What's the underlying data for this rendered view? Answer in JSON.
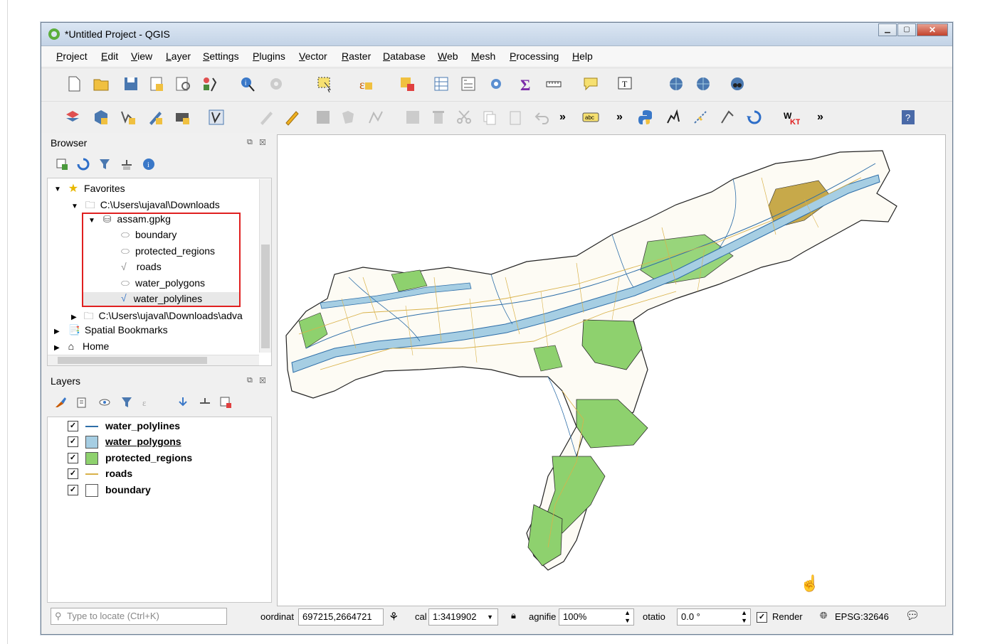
{
  "window": {
    "title": "*Untitled Project - QGIS"
  },
  "menu": [
    "Project",
    "Edit",
    "View",
    "Layer",
    "Settings",
    "Plugins",
    "Vector",
    "Raster",
    "Database",
    "Web",
    "Mesh",
    "Processing",
    "Help"
  ],
  "toolbar_overflow": "»",
  "browser": {
    "title": "Browser",
    "favorites": "Favorites",
    "downloads": "C:\\Users\\ujaval\\Downloads",
    "gpkg": "assam.gpkg",
    "layers": [
      "boundary",
      "protected_regions",
      "roads",
      "water_polygons",
      "water_polylines"
    ],
    "downloads_adv": "C:\\Users\\ujaval\\Downloads\\adva",
    "bookmarks": "Spatial Bookmarks",
    "home": "Home"
  },
  "layers_panel": {
    "title": "Layers",
    "items": [
      {
        "name": "water_polylines",
        "swatch": "line",
        "color": "#2e6ea8"
      },
      {
        "name": "water_polygons",
        "swatch": "fill",
        "color": "#a6cee3"
      },
      {
        "name": "protected_regions",
        "swatch": "fill",
        "color": "#8ed16e"
      },
      {
        "name": "roads",
        "swatch": "line",
        "color": "#d9b24a"
      },
      {
        "name": "boundary",
        "swatch": "fill",
        "color": "#ffffff"
      }
    ]
  },
  "status": {
    "locator_placeholder": "Type to locate (Ctrl+K)",
    "coordinate_label": "oordinat",
    "coordinate": "697215,2664721",
    "scale_label": "cal",
    "scale": "1:3419902",
    "magnifier_label": "agnifie",
    "magnifier": "100%",
    "rotation_label": "otatio",
    "rotation": "0.0 °",
    "render": "Render",
    "crs": "EPSG:32646"
  },
  "colors": {
    "water": "#a6cee3",
    "water_line": "#2e6ea8",
    "protected": "#8ed16e",
    "roads": "#d9b24a",
    "boundary": "#222222",
    "highlight": "#e02020"
  }
}
